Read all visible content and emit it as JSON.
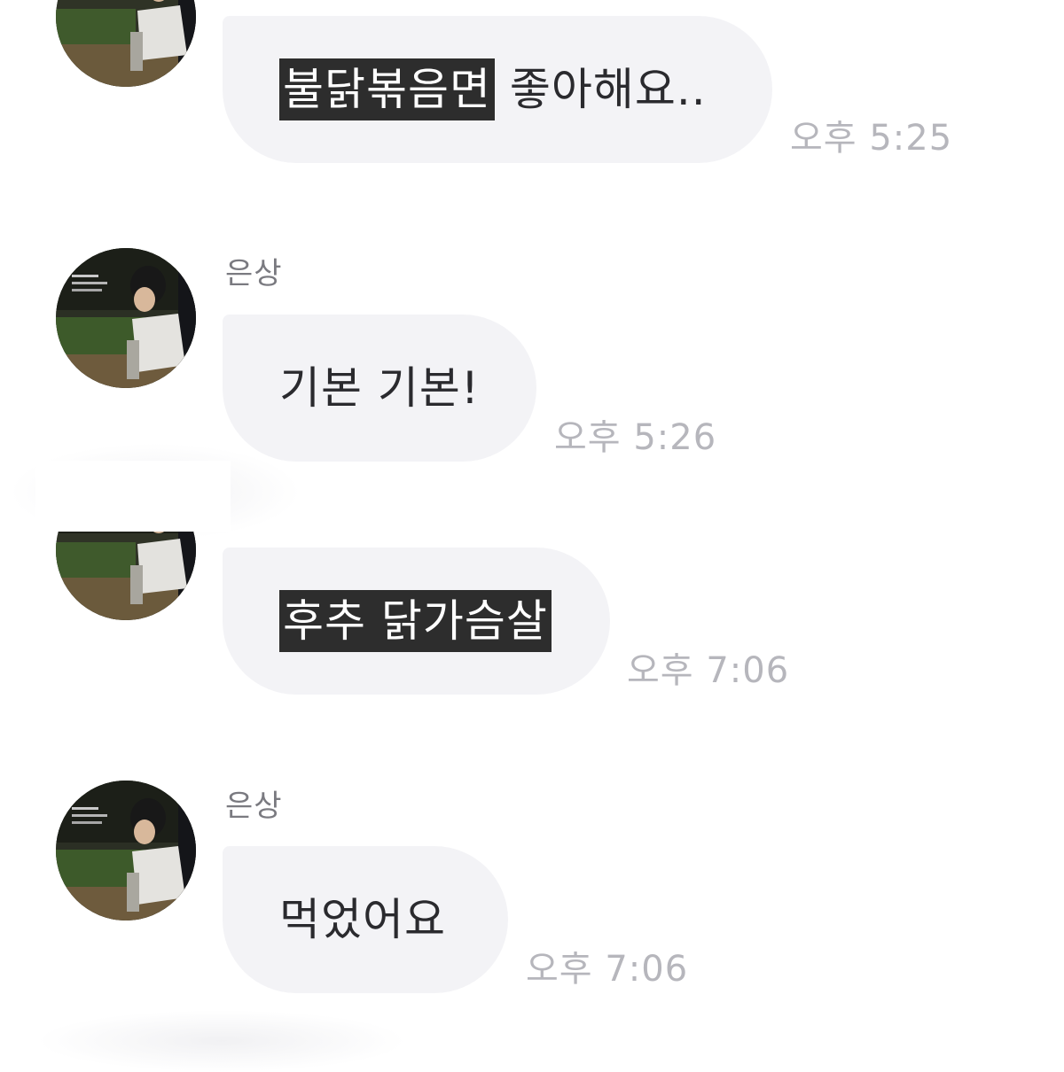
{
  "messages": [
    {
      "sender": "",
      "segments": [
        {
          "text": "불닭볶음면",
          "highlight": true
        },
        {
          "text": " 좋아해요..",
          "highlight": false
        }
      ],
      "time": "오후 5:25"
    },
    {
      "sender": "은상",
      "segments": [
        {
          "text": "기본 기본!",
          "highlight": false
        }
      ],
      "time": "오후 5:26"
    },
    {
      "sender": "",
      "segments": [
        {
          "text": "후추 닭가슴살",
          "highlight": true
        }
      ],
      "time": "오후 7:06"
    },
    {
      "sender": "은상",
      "segments": [
        {
          "text": "먹었어요",
          "highlight": false
        }
      ],
      "time": "오후 7:06"
    }
  ],
  "colors": {
    "background": "#ffffff",
    "bubble": "#f3f3f6",
    "highlight_bg": "#2d2d2d",
    "highlight_fg": "#ffffff",
    "message_text": "#2a2a2e",
    "time_text": "#b6b6bc",
    "sender_text": "#7a7a80"
  },
  "icons": {
    "avatar": "profile-photo-avatar-icon"
  }
}
